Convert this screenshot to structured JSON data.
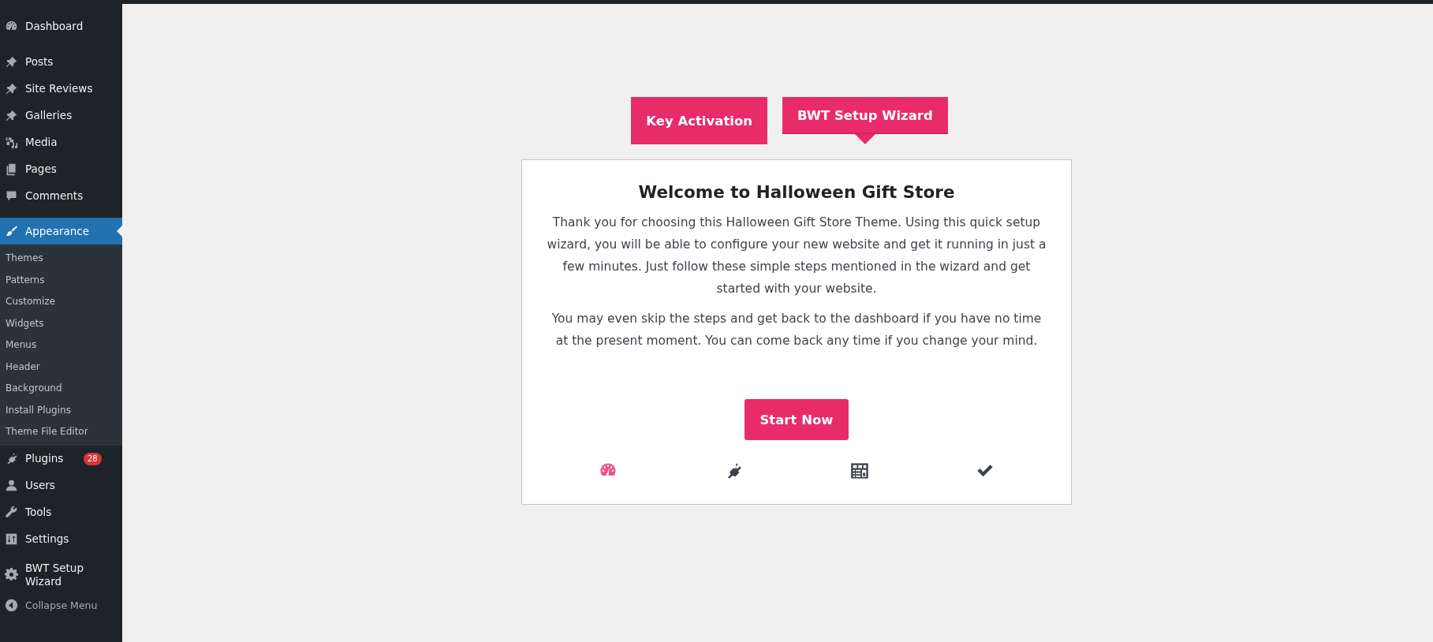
{
  "sidebar": {
    "groups": [
      {
        "items": [
          {
            "label": "Dashboard",
            "kind": "gauge",
            "selected": false
          }
        ]
      },
      {
        "items": [
          {
            "label": "Posts",
            "kind": "pin",
            "selected": false
          },
          {
            "label": "Site Reviews",
            "kind": "pin",
            "selected": false
          },
          {
            "label": "Galleries",
            "kind": "pin",
            "selected": false
          },
          {
            "label": "Media",
            "kind": "media",
            "selected": false
          },
          {
            "label": "Pages",
            "kind": "pages",
            "selected": false
          },
          {
            "label": "Comments",
            "kind": "comment",
            "selected": false
          }
        ]
      },
      {
        "items": [
          {
            "label": "Appearance",
            "kind": "brush",
            "selected": true,
            "children": [
              {
                "label": "Themes"
              },
              {
                "label": "Patterns"
              },
              {
                "label": "Customize"
              },
              {
                "label": "Widgets"
              },
              {
                "label": "Menus"
              },
              {
                "label": "Header"
              },
              {
                "label": "Background"
              },
              {
                "label": "Install Plugins"
              },
              {
                "label": "Theme File Editor"
              }
            ]
          },
          {
            "label": "Plugins",
            "kind": "plug",
            "selected": false,
            "badge": "28"
          },
          {
            "label": "Users",
            "kind": "user",
            "selected": false
          },
          {
            "label": "Tools",
            "kind": "wrench",
            "selected": false
          },
          {
            "label": "Settings",
            "kind": "sliders",
            "selected": false
          }
        ]
      },
      {
        "items": [
          {
            "label": "BWT Setup Wizard",
            "kind": "gear",
            "selected": false
          }
        ]
      }
    ],
    "collapse": "Collapse Menu"
  },
  "tabs": [
    {
      "label": "Key Activation",
      "selected": false
    },
    {
      "label": "BWT Setup Wizard",
      "selected": true
    }
  ],
  "card": {
    "title": "Welcome to Halloween Gift Store",
    "paragraphs": [
      "Thank you for choosing this Halloween Gift Store Theme. Using this quick setup wizard, you will be able to configure your new website and get it running in just a few minutes. Just follow these simple steps mentioned in the wizard and get started with your website.",
      "You may even skip the steps and get back to the dashboard if you have no time at the present moment. You can come back any time if you change your mind."
    ],
    "button": "Start Now",
    "steps": [
      {
        "kind": "gauge",
        "selected": true
      },
      {
        "kind": "plug",
        "selected": false
      },
      {
        "kind": "layout",
        "selected": false
      },
      {
        "kind": "check",
        "selected": false
      }
    ]
  }
}
